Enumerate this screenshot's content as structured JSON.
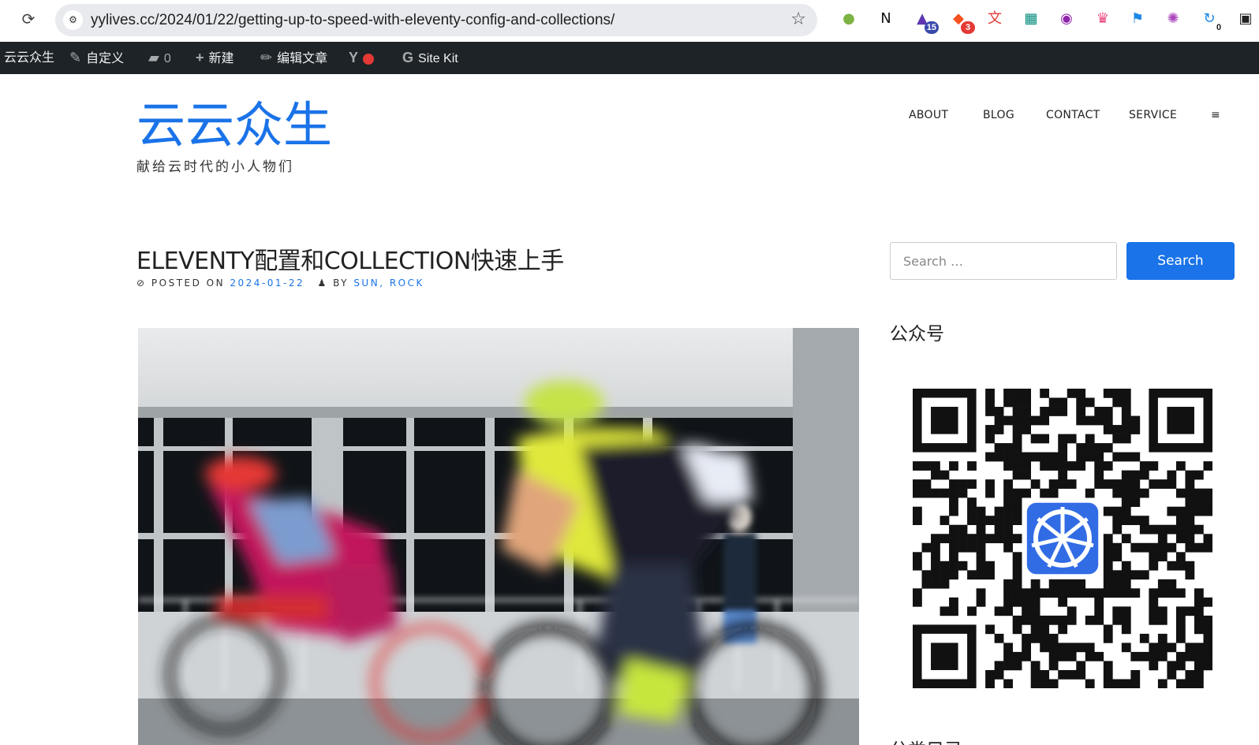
{
  "browser": {
    "url": "yylives.cc/2024/01/22/getting-up-to-speed-with-eleventy-config-and-collections/",
    "extensions": [
      {
        "icon": "green-dot-extension-icon",
        "badge": "",
        "color": "#7cb342"
      },
      {
        "icon": "notion-icon",
        "badge": "",
        "color": "#111111"
      },
      {
        "icon": "graduation-cap-icon",
        "badge": "15",
        "color": "#5e35b1"
      },
      {
        "icon": "chat-bubbles-icon",
        "badge": "3",
        "color": "#f4511e"
      },
      {
        "icon": "translate-icon",
        "badge": "",
        "color": "#e53935"
      },
      {
        "icon": "grid-pattern-icon",
        "badge": "",
        "color": "#00897b"
      },
      {
        "icon": "lr-circle-icon",
        "badge": "",
        "color": "#8e24aa"
      },
      {
        "icon": "crown-icon",
        "badge": "",
        "color": "#ec407a"
      },
      {
        "icon": "blue-flag-icon",
        "badge": "",
        "color": "#1e88e5"
      },
      {
        "icon": "openai-icon",
        "badge": "",
        "color": "#ab47bc"
      },
      {
        "icon": "refresh-counter-icon",
        "badge": "0",
        "color": "#1e88e5"
      },
      {
        "icon": "dark-square-extension-icon",
        "badge": "",
        "color": "#222222"
      }
    ]
  },
  "adminbar": {
    "site": "云云众生",
    "customize": "自定义",
    "comments_count": "0",
    "new": "新建",
    "edit": "编辑文章",
    "sitekit": "Site Kit"
  },
  "header": {
    "title": "云云众生",
    "tagline": "献给云时代的小人物们",
    "nav": [
      "ABOUT",
      "BLOG",
      "CONTACT",
      "SERVICE",
      "≡"
    ]
  },
  "post": {
    "title": "ELEVENTY配置和COLLECTION快速上手",
    "posted_on_label": "POSTED ON",
    "date": "2024-01-22",
    "by_label": "BY",
    "authors": "SUN, ROCK"
  },
  "sidebar": {
    "search_placeholder": "Search …",
    "search_button": "Search",
    "widget1_title": "公众号",
    "widget2_title": "分类目录"
  },
  "colors": {
    "accent": "#1a73e8",
    "adminbar_bg": "#1d2327"
  }
}
